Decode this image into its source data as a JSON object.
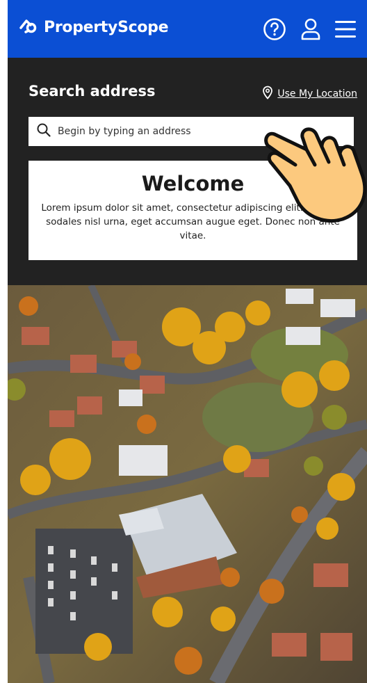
{
  "header": {
    "brand": "PropertyScope",
    "help_icon": "question-circle-icon",
    "user_icon": "user-icon",
    "menu_icon": "hamburger-menu-icon"
  },
  "search": {
    "title": "Search address",
    "use_location_label": "Use My Location",
    "placeholder": "Begin by typing an address"
  },
  "welcome": {
    "title": "Welcome",
    "body": "Lorem ipsum dolor sit amet, consectetur adipiscing elit. Aliquam sodales nisl urna, eget accumsan augue  eget. Donec non ante vitae."
  },
  "colors": {
    "brand_blue": "#0b4fd4",
    "panel_dark": "#222222",
    "hand_fill": "#fcc97e"
  }
}
